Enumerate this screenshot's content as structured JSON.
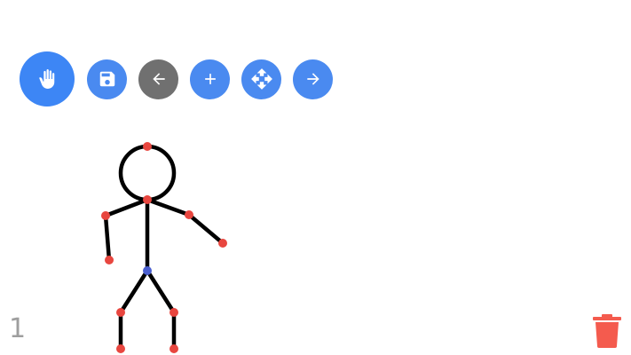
{
  "colors": {
    "tool_active": "#4a8af0",
    "tool_primary": "#3d86f5",
    "tool_back_disabled": "#707070",
    "joint": "#e8463f",
    "hip_joint": "#4a5fd0",
    "limb": "#000000",
    "trash": "#f45b4e",
    "frame_number": "#9e9e9e"
  },
  "toolbar": {
    "tools": [
      {
        "icon": "hand-icon",
        "action": "pan"
      },
      {
        "icon": "save-icon",
        "action": "save"
      },
      {
        "icon": "arrow-left-icon",
        "action": "previous-frame"
      },
      {
        "icon": "plus-icon",
        "action": "add-frame"
      },
      {
        "icon": "move-icon",
        "action": "move"
      },
      {
        "icon": "arrow-right-icon",
        "action": "next-frame"
      }
    ]
  },
  "frame": {
    "number": "1"
  },
  "trash": {
    "icon": "trash-icon"
  }
}
